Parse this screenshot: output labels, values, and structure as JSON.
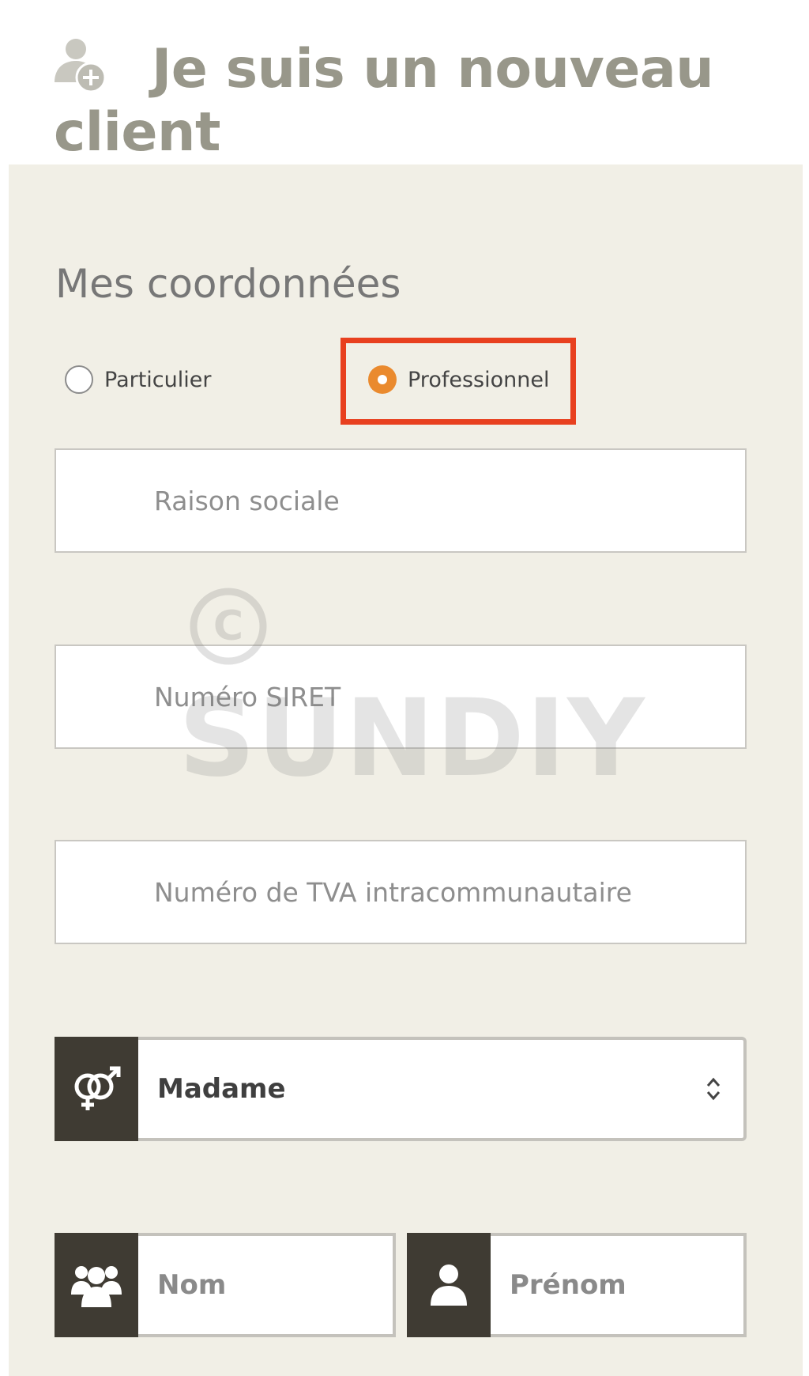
{
  "header": {
    "title": "Je suis un nouveau client"
  },
  "form": {
    "section_title": "Mes coordonnées",
    "customer_type": {
      "options": [
        {
          "label": "Particulier",
          "checked": false
        },
        {
          "label": "Professionnel",
          "checked": true
        }
      ],
      "accent_color": "#ea8a2e",
      "highlight_color": "#e8401f"
    },
    "fields": {
      "raison_sociale": {
        "placeholder": "Raison sociale",
        "value": ""
      },
      "siret": {
        "placeholder": "Numéro SIRET",
        "value": ""
      },
      "tva": {
        "placeholder": "Numéro de TVA intracommunautaire",
        "value": ""
      }
    },
    "civility": {
      "icon": "gender-icon",
      "selected": "Madame"
    },
    "nom": {
      "icon": "group-icon",
      "placeholder": "Nom",
      "value": ""
    },
    "prenom": {
      "icon": "user-icon",
      "placeholder": "Prénom",
      "value": ""
    }
  },
  "watermark": {
    "symbol": "©",
    "text": "SUNDIY"
  }
}
